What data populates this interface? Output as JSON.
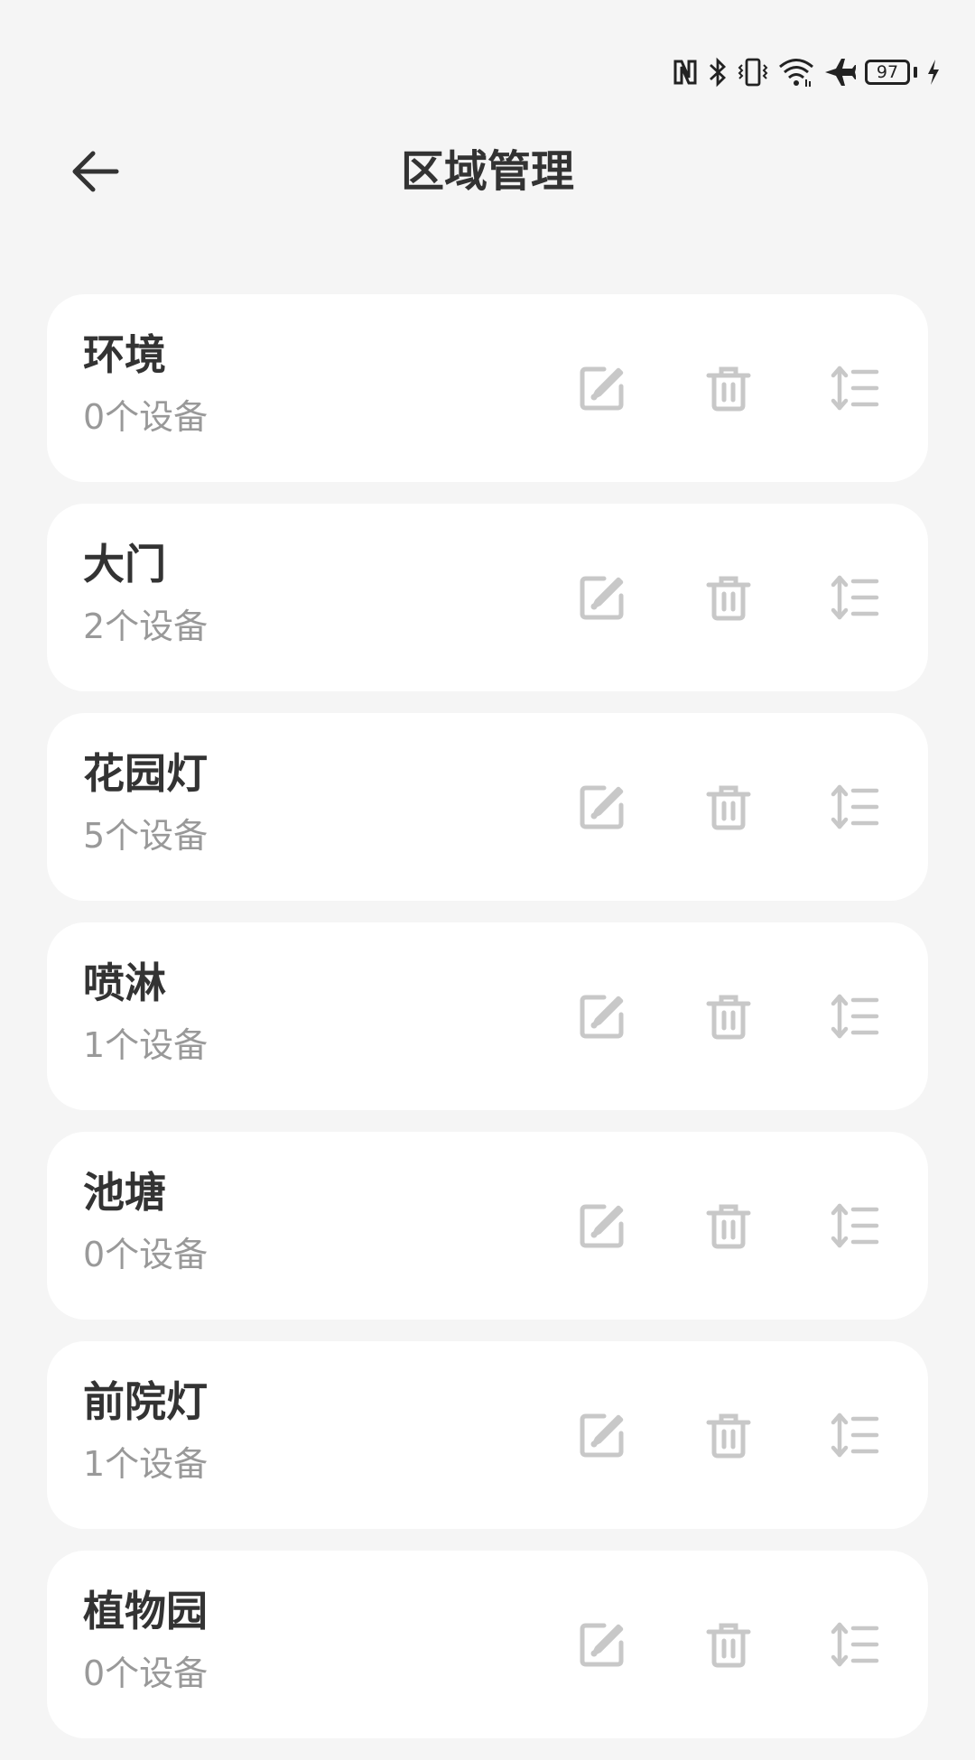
{
  "status_bar": {
    "icons": [
      "nfc-icon",
      "bluetooth-icon",
      "vibrate-icon",
      "wifi-icon",
      "airplane-mode-icon",
      "battery-icon",
      "charging-icon"
    ],
    "battery_level": "97"
  },
  "header": {
    "title": "区域管理",
    "back_icon": "arrow-left-icon"
  },
  "colors": {
    "background": "#f5f5f5",
    "card": "#ffffff",
    "title_text": "#333333",
    "sub_text": "#999999",
    "action_icon": "#c8c8c8"
  },
  "areas": [
    {
      "name": "环境",
      "count": "0个设备"
    },
    {
      "name": "大门",
      "count": "2个设备"
    },
    {
      "name": "花园灯",
      "count": "5个设备"
    },
    {
      "name": "喷淋",
      "count": "1个设备"
    },
    {
      "name": "池塘",
      "count": "0个设备"
    },
    {
      "name": "前院灯",
      "count": "1个设备"
    },
    {
      "name": "植物园",
      "count": "0个设备"
    }
  ],
  "action_icons": [
    "edit-icon",
    "trash-icon",
    "sort-icon"
  ]
}
